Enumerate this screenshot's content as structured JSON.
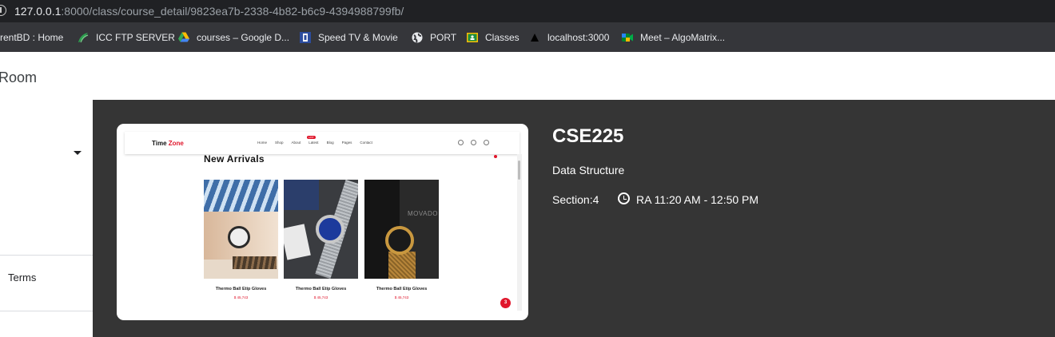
{
  "browser": {
    "url_host": "127.0.0.1",
    "url_path": ":8000/class/course_detail/9823ea7b-2338-4b82-b6c9-4394988799fb/",
    "bookmarks": [
      {
        "label": "rrentBD : Home",
        "icon": "none"
      },
      {
        "label": "ICC FTP SERVER",
        "icon": "leaf-icon"
      },
      {
        "label": "courses – Google D...",
        "icon": "google-drive-icon"
      },
      {
        "label": "Speed TV & Movie",
        "icon": "tv-icon"
      },
      {
        "label": "PORT",
        "icon": "globe-icon"
      },
      {
        "label": "Classes",
        "icon": "classroom-icon"
      },
      {
        "label": "localhost:3000",
        "icon": "vercel-triangle-icon"
      },
      {
        "label": "Meet – AlgoMatrix...",
        "icon": "google-meet-icon"
      }
    ]
  },
  "header": {
    "title": "Room"
  },
  "sidebar": {
    "terms_label": "Terms"
  },
  "course": {
    "code": "CSE225",
    "name": "Data Structure",
    "section": "Section:4",
    "schedule": "RA 11:20 AM - 12:50 PM"
  },
  "preview": {
    "logo_main": "Time ",
    "logo_accent": "Zone",
    "nav_links": [
      "Home",
      "Shop",
      "About",
      "Latest",
      "Blog",
      "Pages",
      "Contact"
    ],
    "hot_badge": "HOT",
    "heading": "New Arrivals",
    "chat_badge": "3",
    "products": [
      {
        "name": "Thermo Ball Etip Gloves",
        "price": "$ 45,743"
      },
      {
        "name": "Thermo Ball Etip Gloves",
        "price": "$ 45,743"
      },
      {
        "name": "Thermo Ball Etip Gloves",
        "price": "$ 45,743"
      }
    ],
    "product3_brand": "MOVADO"
  },
  "colors": {
    "main_bg": "#353535",
    "accent_red": "#e0162b",
    "bookmarks_bg": "#35363a",
    "address_bg": "#202124"
  }
}
